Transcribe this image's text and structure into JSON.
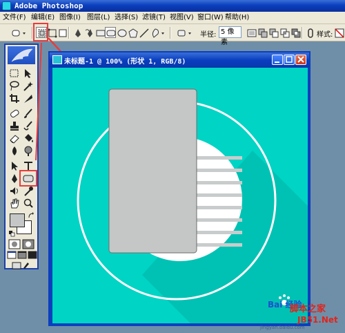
{
  "app": {
    "title": "Adobe Photoshop"
  },
  "menu": {
    "items": [
      "文件(F)",
      "编辑(E)",
      "图像(I)",
      "图层(L)",
      "选择(S)",
      "滤镜(T)",
      "视图(V)",
      "窗口(W)",
      "帮助(H)"
    ]
  },
  "options": {
    "radius_label": "半径:",
    "radius_value": "5 像素",
    "style_label": "样式:"
  },
  "document": {
    "title": "未标题-1 @ 100% (形状 1, RGB/8)"
  },
  "colors": {
    "canvas_bg": "#00d4c4",
    "long_shadow": "#00c2b4",
    "card": "#c4c7c6",
    "stripe": "#c9cccc",
    "highlight": "#e83c3c",
    "window_blue": "#0a3fbf"
  },
  "watermark": {
    "baidu": "Bai 经验",
    "jingyan": "jingyan.baidu.com",
    "site": "脚本之家",
    "domain": "JB51.Net"
  }
}
